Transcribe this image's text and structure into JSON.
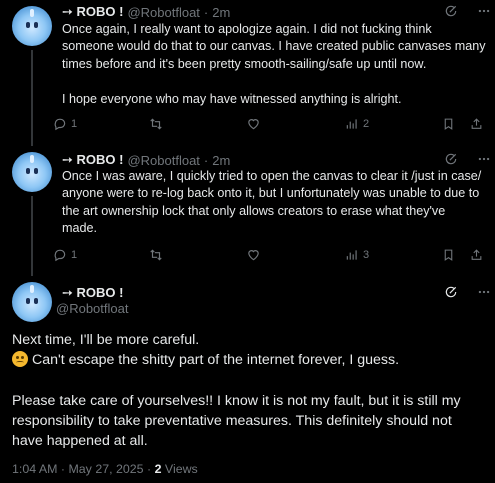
{
  "posts": [
    {
      "name": "➙ ROBO !",
      "handle": "@Robotfloat",
      "dot": "·",
      "time": "2m",
      "lines": [
        "Once again, I really want to apologize again. I did not fucking think",
        "someone would do that to our canvas. I have created public canvases many",
        "times before and it's been pretty smooth-sailing/safe up until now.",
        "",
        "I hope everyone who may have witnessed anything is alright."
      ],
      "replies": "1",
      "views": "2"
    },
    {
      "name": "➙ ROBO !",
      "handle": "@Robotfloat",
      "dot": "·",
      "time": "2m",
      "lines": [
        "Once I was aware, I quickly tried to open the canvas to clear it /just in case/",
        "anyone were to re-log back onto it, but I unfortunately was unable to due to",
        "the art ownership lock that only allows creators to erase what they've",
        "made."
      ],
      "replies": "1",
      "views": "3"
    }
  ],
  "main": {
    "name": "➙ ROBO !",
    "handle": "@Robotfloat",
    "para1": "Next time, I'll be more careful.",
    "para2": "Can't escape the shitty part of the internet forever, I guess.",
    "para3": "Please take care of yourselves!! I know it is not my fault, but it is still my responsibility to take preventative measures. This definitely should not have happened at all.",
    "time": "1:04 AM · May 27, 2025 · ",
    "views_count": "2",
    "views_label": " Views"
  },
  "icons": [
    "edit-icon",
    "more-icon",
    "reply-icon",
    "retweet-icon",
    "like-icon",
    "views-icon",
    "bookmark-icon",
    "share-icon",
    "grok-icon",
    "frowning-emoji-icon"
  ]
}
